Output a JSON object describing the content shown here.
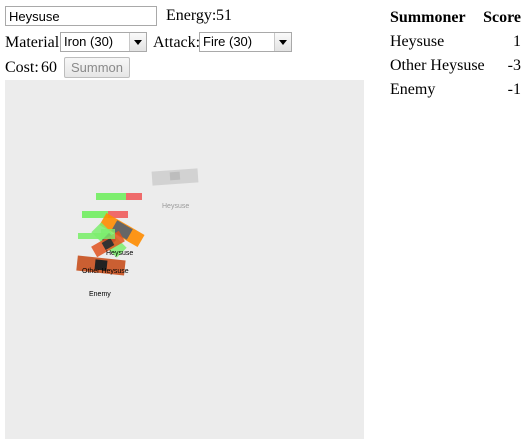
{
  "controls": {
    "name_value": "Heysuse",
    "energy_label": "Energy:",
    "energy_value": "51",
    "material_label": "Material:",
    "material_selected": "Iron (30)",
    "attack_label": "Attack:",
    "attack_selected": "Fire (30)",
    "cost_label": "Cost:",
    "cost_value": "60",
    "summon_label": "Summon"
  },
  "scoreboard": {
    "header_summoner": "Summoner",
    "header_score": "Score",
    "rows": [
      {
        "name": "Heysuse",
        "score": "1"
      },
      {
        "name": "Other Heysuse",
        "score": "-3"
      },
      {
        "name": "Enemy",
        "score": "-1"
      }
    ]
  },
  "arena": {
    "labels": {
      "heysuse_ghost": "Heysuse",
      "heysuse": "Heysuse",
      "other_heysuse": "Other Heysuse",
      "enemy": "Enemy"
    },
    "colors": {
      "background": "#ececec",
      "health_full": "#7dee6e",
      "health_lost": "#ef6b6b",
      "iron": "#666666",
      "fire": "#ff8c00",
      "enemy_unit": "#c8501e",
      "ghost": "#cccccc"
    }
  }
}
